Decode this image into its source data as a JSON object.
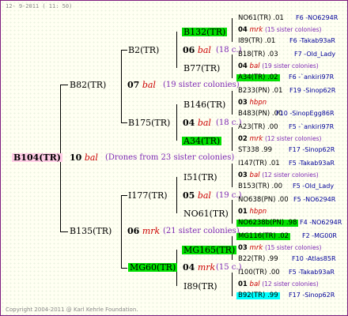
{
  "header": "12-  9-2011 ( 11: 50)",
  "footer": "Copyright 2004-2011 @ Karl Kehrle Foundation.",
  "root": {
    "name": "B104(TR)",
    "year": "10",
    "race": "bal",
    "note": "(Drones from 23 sister colonies)"
  },
  "g1": [
    {
      "name": "B82(TR)",
      "year": "07",
      "race": "bal",
      "note": "(19 sister colonies)"
    },
    {
      "name": "B135(TR)",
      "year": "06",
      "race": "mrk",
      "note": "(21 sister colonies)"
    }
  ],
  "g2": [
    {
      "name": "B2(TR)",
      "year": "06",
      "race": "bal",
      "note": "(18 c.)"
    },
    {
      "name": "B175(TR)",
      "year": "04",
      "race": "bal",
      "note": "(18 c.)"
    },
    {
      "name": "I177(TR)",
      "year": "05",
      "race": "bal",
      "note": "(19 c.)"
    },
    {
      "name": "MG60(TR)",
      "year": "04",
      "race": "mrk",
      "note": "(15 c.)"
    }
  ],
  "g3": [
    {
      "name": "B132(TR)"
    },
    {
      "name": "B77(TR)"
    },
    {
      "name": "B146(TR)"
    },
    {
      "name": "A34(TR)"
    },
    {
      "name": "I51(TR)"
    },
    {
      "name": "NO61(TR)"
    },
    {
      "name": "MG165(TR)"
    },
    {
      "name": "I89(TR)"
    }
  ],
  "g4": [
    {
      "a": "NO61(TR) .01",
      "b": "F6 -NO6294R",
      "y": "04",
      "r": "mrk",
      "n": "(15 sister colonies)",
      "c": "I89(TR) .01",
      "d": "F6 -Takab93aR"
    },
    {
      "a": "B18(TR) .03",
      "b": "F7 -Old_Lady",
      "y": "04",
      "r": "bal",
      "n": "(19 sister colonies)",
      "c": "A34(TR) .02",
      "d": "F6 -`ankiri97R"
    },
    {
      "a": "B233(PN) .01",
      "b": "F19 -Sinop62R",
      "y": "03",
      "r": "hbpn",
      "n": "",
      "c": "B483(PN) .00",
      "d": "F10 -SinopEgg86R"
    },
    {
      "a": "A23(TR) .00",
      "b": "F5 -`ankiri97R",
      "y": "02",
      "r": "mrk",
      "n": "(12 sister colonies)",
      "c": "ST338 .99",
      "d": "F17 -Sinop62R"
    },
    {
      "a": "I147(TR) .01",
      "b": "F5 -Takab93aR",
      "y": "03",
      "r": "bal",
      "n": "(12 sister colonies)",
      "c": "B153(TR) .00",
      "d": "F5 -Old_Lady"
    },
    {
      "a": "NO638(PN) .00",
      "b": "F5 -NO6294R",
      "y": "01",
      "r": "hbpn",
      "n": "",
      "c": "NO6238b(PN) .98",
      "d": "F4 -NO6294R"
    },
    {
      "a": "MG116(TR) .02",
      "b": "F2 -MG00R",
      "y": "03",
      "r": "mrk",
      "n": "(15 sister colonies)",
      "c": "B22(TR) .99",
      "d": "F10 -Atlas85R"
    },
    {
      "a": "I100(TR) .00",
      "b": "F5 -Takab93aR",
      "y": "01",
      "r": "bal",
      "n": "(12 sister colonies)",
      "c": "B92(TR) .99",
      "d": "F17 -Sinop62R"
    }
  ]
}
